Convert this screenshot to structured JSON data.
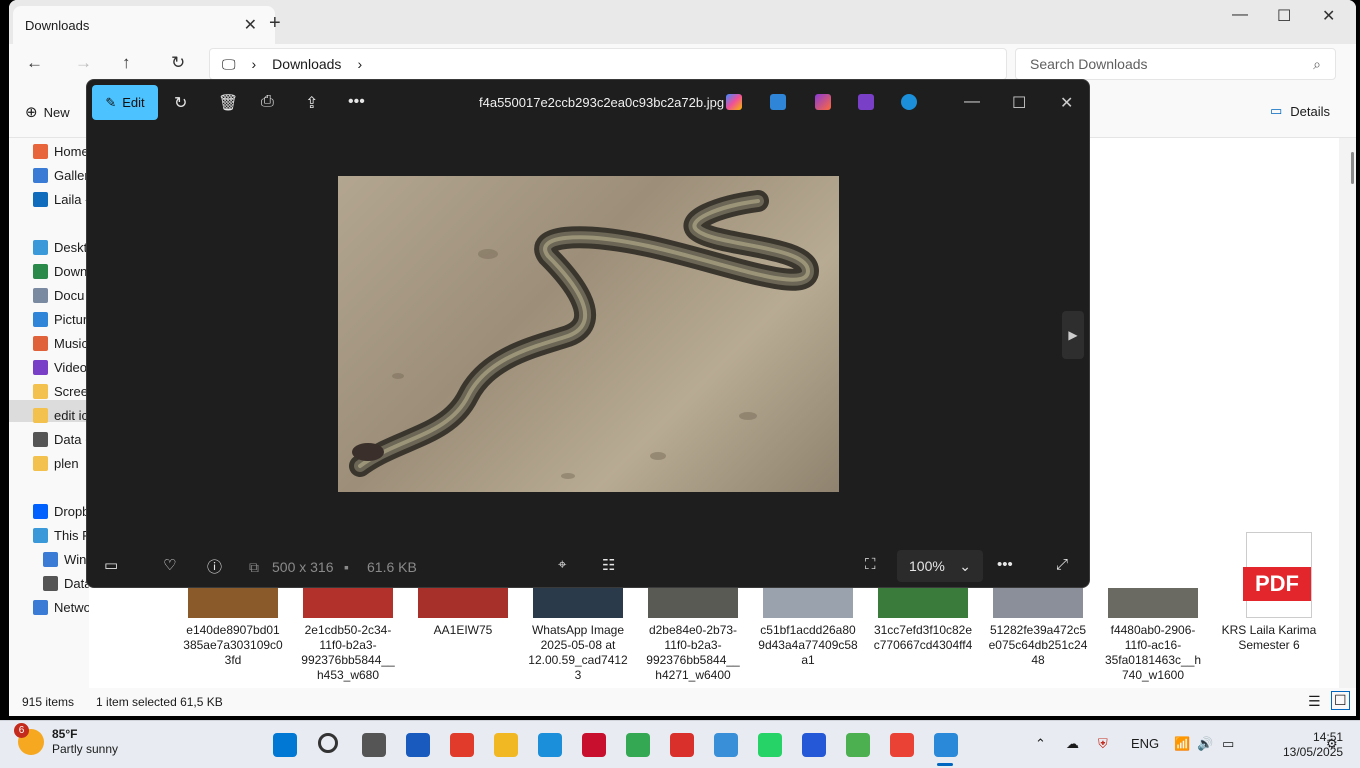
{
  "explorer": {
    "tab_title": "Downloads",
    "breadcrumb": "Downloads",
    "search_placeholder": "Search Downloads",
    "new_label": "New",
    "details_label": "Details",
    "sidebar": [
      {
        "label": "Home",
        "icon": "home-icon",
        "color": "#e8643a"
      },
      {
        "label": "Galler",
        "icon": "gallery-icon",
        "color": "#3a7bd5"
      },
      {
        "label": "Laila -",
        "icon": "onedrive-icon",
        "color": "#0f6cbd"
      },
      {
        "label": "Deskto",
        "icon": "desktop-icon",
        "color": "#3a9ad9"
      },
      {
        "label": "Down",
        "icon": "download-icon",
        "color": "#2a8a4a"
      },
      {
        "label": "Docu",
        "icon": "document-icon",
        "color": "#7a8aa0"
      },
      {
        "label": "Pictur",
        "icon": "pictures-icon",
        "color": "#2f85d8"
      },
      {
        "label": "Music",
        "icon": "music-icon",
        "color": "#e0623a"
      },
      {
        "label": "Video",
        "icon": "video-icon",
        "color": "#7a3fc7"
      },
      {
        "label": "Screer",
        "icon": "folder-icon",
        "color": "#f2c14e"
      },
      {
        "label": "edit ic",
        "icon": "folder-icon",
        "color": "#f2c14e"
      },
      {
        "label": "Data (",
        "icon": "drive-icon",
        "color": "#555555"
      },
      {
        "label": "plen",
        "icon": "folder-icon",
        "color": "#f2c14e"
      },
      {
        "label": "Dropb",
        "icon": "dropbox-icon",
        "color": "#0061fe"
      },
      {
        "label": "This P",
        "icon": "pc-icon",
        "color": "#3a9ad9"
      },
      {
        "label": "Win",
        "icon": "windows-drive-icon",
        "color": "#3a7bd5"
      },
      {
        "label": "Data",
        "icon": "drive-icon",
        "color": "#555555"
      },
      {
        "label": "Network",
        "icon": "network-icon",
        "color": "#3a7bd5"
      }
    ],
    "files": [
      {
        "name": "e140de8907bd01385ae7a303109c03fd",
        "thumb": "#8a5a2a"
      },
      {
        "name": "2e1cdb50-2c34-11f0-b2a3-992376bb5844__h453_w680",
        "thumb": "#b2312a"
      },
      {
        "name": "AA1EIW75",
        "thumb": "#a8302b"
      },
      {
        "name": "WhatsApp Image 2025-05-08 at 12.00.59_cad74123",
        "thumb": "#2a3a4a"
      },
      {
        "name": "d2be84e0-2b73-11f0-b2a3-992376bb5844__h4271_w6400",
        "thumb": "#5a5a55"
      },
      {
        "name": "c51bf1acdd26a809d43a4a77409c58a1",
        "thumb": "#9aa3ad"
      },
      {
        "name": "31cc7efd3f10c82ec770667cd4304ff4",
        "thumb": "#3a7a3a"
      },
      {
        "name": "51282fe39a472c5e075c64db251c2448",
        "thumb": "#8a8f9a"
      },
      {
        "name": "f4480ab0-2906-11f0-ac16-35fa0181463c__h740_w1600",
        "thumb": "#6a6a62"
      },
      {
        "name": "KRS Laila Karima Semester 6",
        "thumb": "pdf"
      }
    ],
    "pdf_label": "PDF",
    "status_items": "915 items",
    "status_selected": "1 item selected  61,5 KB"
  },
  "viewer": {
    "edit_label": "Edit",
    "filename": "f4a550017e2ccb293c2ea0c93bc2a72b.jpg",
    "dimensions": "500 x 316",
    "filesize": "61.6 KB",
    "zoom": "100%"
  },
  "taskbar": {
    "badge": "6",
    "temperature": "85°F",
    "condition": "Partly sunny",
    "language": "ENG",
    "time": "14:51",
    "date": "13/05/2025",
    "apps": [
      {
        "name": "start-button",
        "color": "#0078d4"
      },
      {
        "name": "search-button",
        "color": "#333333"
      },
      {
        "name": "task-view-button",
        "color": "#555555"
      },
      {
        "name": "word-app",
        "color": "#185abd"
      },
      {
        "name": "wps-app",
        "color": "#e03b2b"
      },
      {
        "name": "file-explorer-app",
        "color": "#f2b824"
      },
      {
        "name": "edge-app",
        "color": "#1b8fd9"
      },
      {
        "name": "mendeley-app",
        "color": "#c8102e"
      },
      {
        "name": "chrome-app",
        "color": "#34a853"
      },
      {
        "name": "se-app",
        "color": "#d9302b"
      },
      {
        "name": "notepad-app",
        "color": "#3a8fd9"
      },
      {
        "name": "whatsapp-app",
        "color": "#25d366"
      },
      {
        "name": "vscode-app",
        "color": "#2458d6"
      },
      {
        "name": "green-app",
        "color": "#4caf50"
      },
      {
        "name": "chrome-profile-app",
        "color": "#ea4335"
      },
      {
        "name": "photos-app",
        "color": "#2a8ad9"
      }
    ]
  }
}
